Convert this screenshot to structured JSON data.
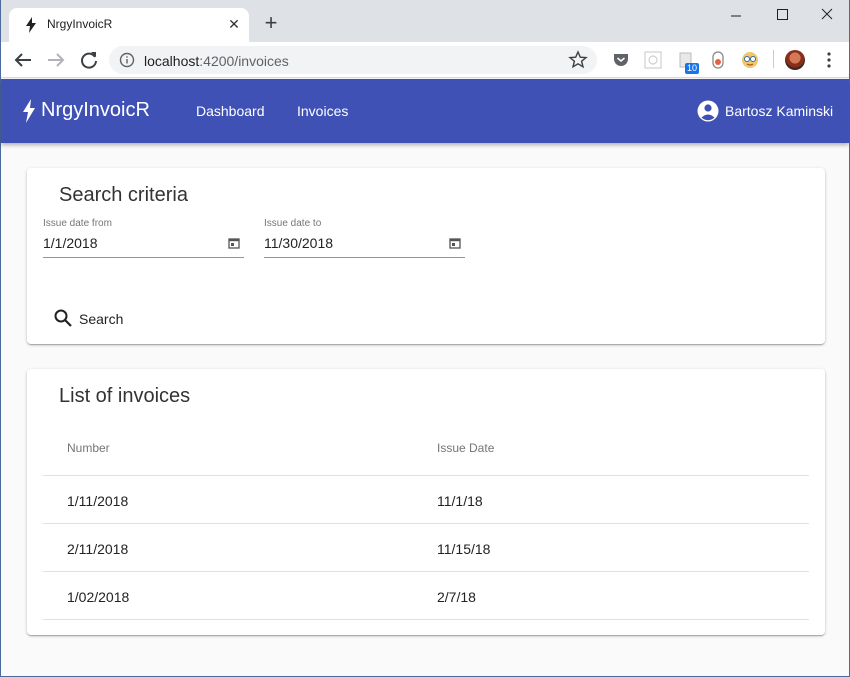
{
  "browser": {
    "tab_title": "NrgyInvoicR",
    "new_tab": "+",
    "url_host": "localhost",
    "url_path": ":4200/invoices",
    "extension_badge": "10"
  },
  "app": {
    "brand": "NrgyInvoicR",
    "nav": [
      "Dashboard",
      "Invoices"
    ],
    "user": "Bartosz Kaminski",
    "brand_color": "#3f51b5"
  },
  "search": {
    "title": "Search criteria",
    "from_label": "Issue date from",
    "from_value": "1/1/2018",
    "to_label": "Issue date to",
    "to_value": "11/30/2018",
    "button_label": "Search"
  },
  "invoices": {
    "title": "List of invoices",
    "columns": [
      "Number",
      "Issue Date"
    ],
    "rows": [
      [
        "1/11/2018",
        "11/1/18"
      ],
      [
        "2/11/2018",
        "11/15/18"
      ],
      [
        "1/02/2018",
        "2/7/18"
      ]
    ]
  }
}
